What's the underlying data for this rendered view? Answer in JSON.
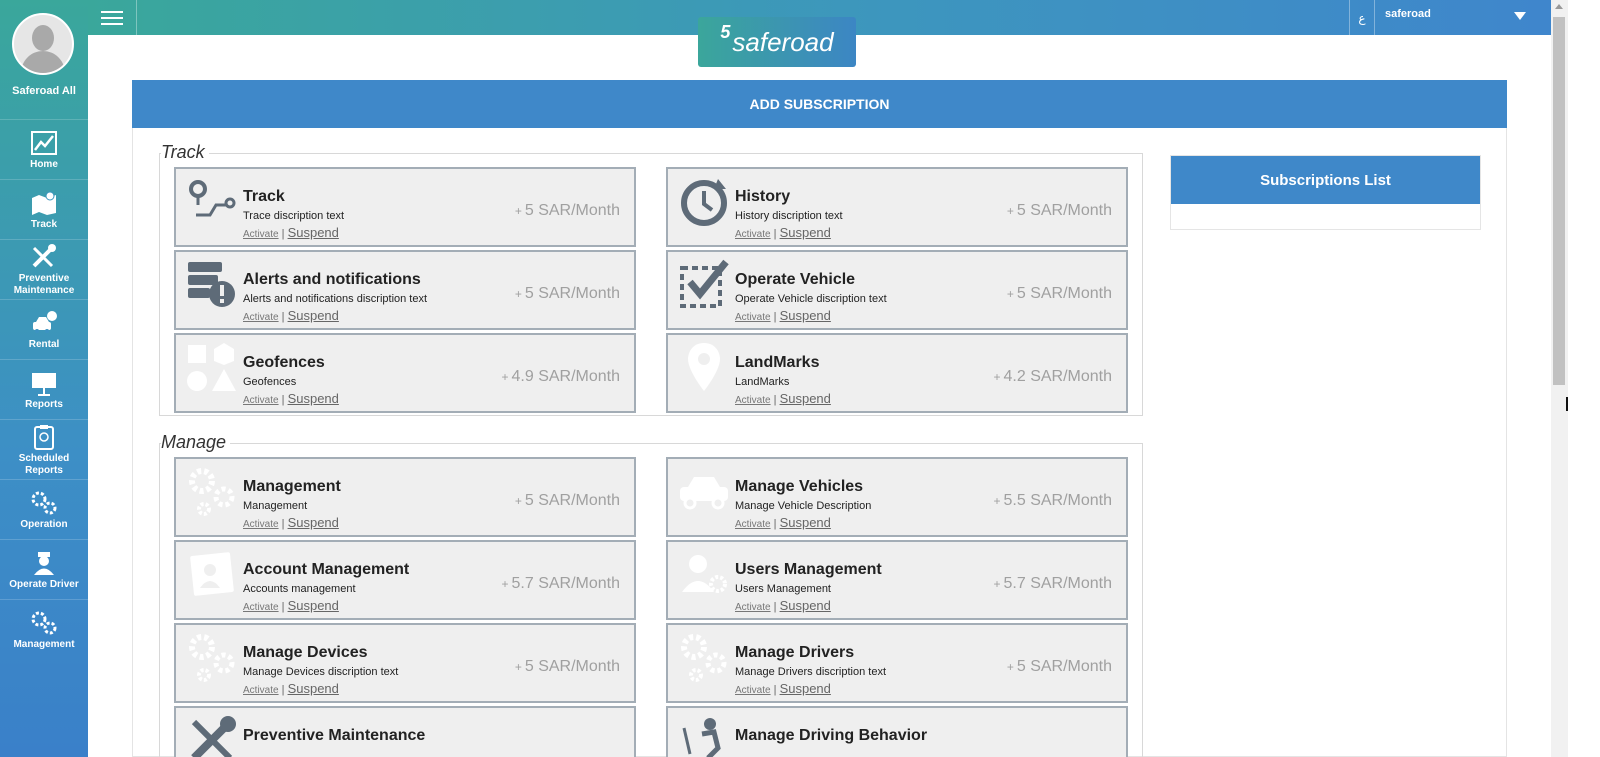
{
  "sidebar": {
    "user_name": "Saferoad All",
    "items": [
      {
        "label": "Home",
        "icon": "chart-icon"
      },
      {
        "label": "Track",
        "icon": "map-icon"
      },
      {
        "label": "Preventive\nMaintenance",
        "icon": "wrench-icon"
      },
      {
        "label": "Rental",
        "icon": "car-dollar-icon"
      },
      {
        "label": "Reports",
        "icon": "presentation-icon"
      },
      {
        "label": "Scheduled\nReports",
        "icon": "clipboard-icon"
      },
      {
        "label": "Operation",
        "icon": "gears-icon"
      },
      {
        "label": "Operate Driver",
        "icon": "driver-icon"
      },
      {
        "label": "Management",
        "icon": "gears-icon"
      }
    ]
  },
  "topbar": {
    "lang": "ع",
    "user": "saferoad",
    "logo_text": "saferoad"
  },
  "panel": {
    "title": "ADD SUBSCRIPTION"
  },
  "subscriptions_list": {
    "title": "Subscriptions List"
  },
  "link_labels": {
    "activate": "Activate",
    "separator": "|",
    "suspend": "Suspend",
    "plus": "+"
  },
  "sections": [
    {
      "title": "Track",
      "cards": [
        {
          "title": "Track",
          "desc": "Trace discription text",
          "price": "5 SAR/Month",
          "icon": "route-icon"
        },
        {
          "title": "History",
          "desc": "History discription text",
          "price": "5 SAR/Month",
          "icon": "history-clock-icon"
        },
        {
          "title": "Alerts and notifications",
          "desc": "Alerts and notifications discription text",
          "price": "5 SAR/Month",
          "icon": "alert-server-icon"
        },
        {
          "title": "Operate Vehicle",
          "desc": "Operate Vehicle discription text",
          "price": "5 SAR/Month",
          "icon": "checkbox-icon"
        },
        {
          "title": "Geofences",
          "desc": "Geofences",
          "price": "4.9 SAR/Month",
          "icon": "shapes-icon"
        },
        {
          "title": "LandMarks",
          "desc": "LandMarks",
          "price": "4.2 SAR/Month",
          "icon": "map-pin-icon"
        }
      ]
    },
    {
      "title": "Manage",
      "cards": [
        {
          "title": "Management",
          "desc": "Management",
          "price": "5 SAR/Month",
          "icon": "gears-icon"
        },
        {
          "title": "Manage Vehicles",
          "desc": "Manage Vehicle Description",
          "price": "5.5 SAR/Month",
          "icon": "car-icon"
        },
        {
          "title": "Account Management",
          "desc": "Accounts management",
          "price": "5.7 SAR/Month",
          "icon": "id-card-icon"
        },
        {
          "title": "Users Management",
          "desc": "Users Management",
          "price": "5.7 SAR/Month",
          "icon": "user-gear-icon"
        },
        {
          "title": "Manage Devices",
          "desc": "Manage Devices discription text",
          "price": "5 SAR/Month",
          "icon": "gears-icon"
        },
        {
          "title": "Manage Drivers",
          "desc": "Manage Drivers discription text",
          "price": "5 SAR/Month",
          "icon": "gears-icon"
        },
        {
          "title": "Preventive Maintenance",
          "desc": "",
          "price": "",
          "icon": "wrench-icon"
        },
        {
          "title": "Manage Driving Behavior",
          "desc": "",
          "price": "",
          "icon": "driver-behavior-icon"
        }
      ]
    }
  ],
  "colors": {
    "accent_blue": "#3f88c9",
    "accent_teal": "#3aa79b",
    "card_border": "#a3adb6",
    "card_bg": "#efefef"
  }
}
